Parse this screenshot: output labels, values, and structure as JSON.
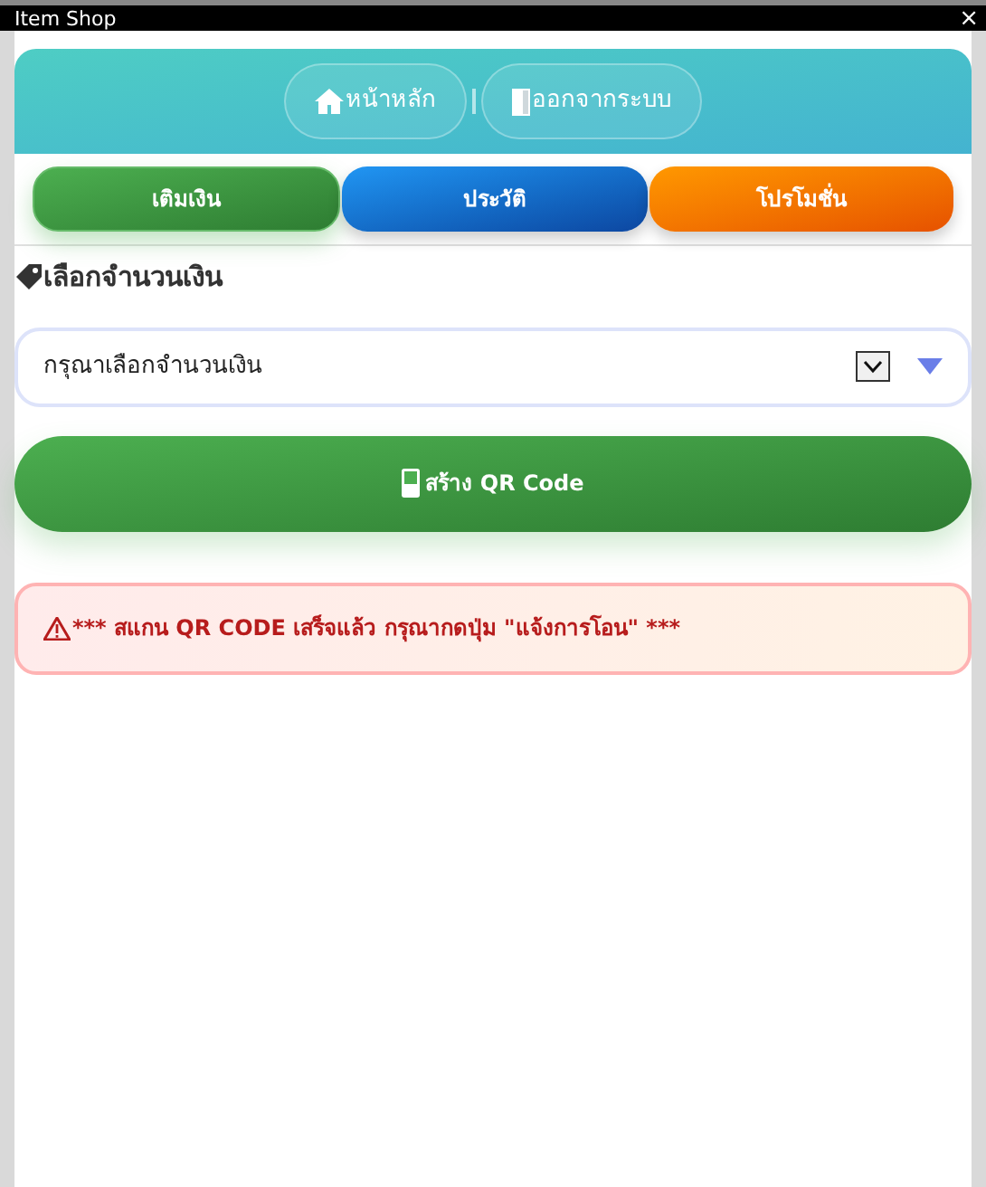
{
  "window": {
    "title": "Item Shop",
    "close": "×"
  },
  "nav": [
    {
      "kind": "home",
      "label": "หน้าหลัก"
    },
    {
      "kind": "logout",
      "label": "ออกจากระบบ"
    }
  ],
  "tabs": [
    {
      "label": "เติมเงิน",
      "color": "#4caf50",
      "selected": true
    },
    {
      "label": "ประวัติ",
      "color": "#2196f3",
      "selected": false
    },
    {
      "label": "โปรโมชั่น",
      "color": "#ff9800",
      "selected": false
    }
  ],
  "section_title": "เลือกจำนวนเงิน",
  "amount_select": {
    "placeholder": "กรุณาเลือกจำนวนเงิน"
  },
  "create_button": "สร้าง QR Code",
  "alert": "*** สแกน QR CODE เสร็จแล้ว กรุณากดปุ่ม \"แจ้งการโอน\" ***"
}
